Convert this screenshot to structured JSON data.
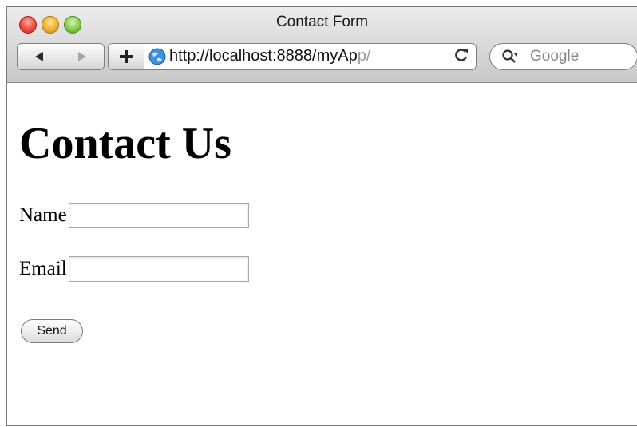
{
  "window": {
    "title": "Contact Form"
  },
  "toolbar": {
    "url_main": "http://localhost:8888/myAp",
    "url_faded": "p/",
    "search_placeholder": "Google",
    "add_label": "+"
  },
  "page": {
    "heading": "Contact Us",
    "name_label": "Name",
    "email_label": "Email",
    "send_label": "Send"
  },
  "icons": {
    "close": "close-icon",
    "minimize": "minimize-icon",
    "zoom": "zoom-icon",
    "back": "back-arrow-icon",
    "forward": "forward-arrow-icon",
    "globe": "globe-icon",
    "reload": "reload-icon",
    "search": "search-icon"
  },
  "colors": {
    "close": "#f2574a",
    "minimize": "#f6b93c",
    "zoom": "#8fd45a"
  }
}
